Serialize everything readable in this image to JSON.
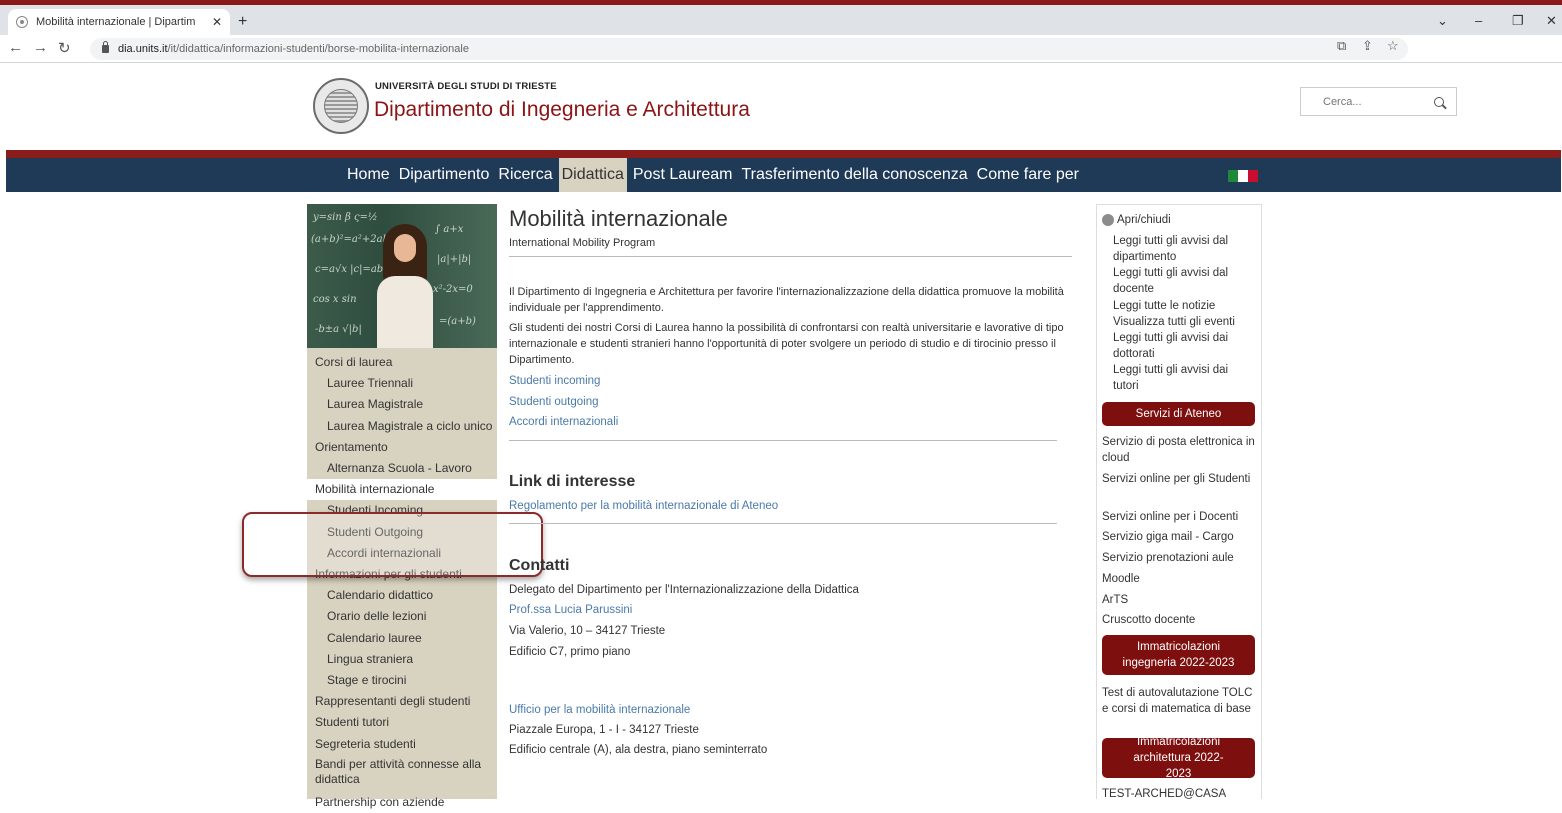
{
  "browser": {
    "tab_title": "Mobilità internazionale | Dipartim",
    "tab_close": "✕",
    "new_tab": "+",
    "url_domain": "dia.units.it",
    "url_path": "/it/didattica/informazioni-studenti/borse-mobilita-internazionale"
  },
  "header": {
    "university": "UNIVERSITÀ DEGLI STUDI DI TRIESTE",
    "department": "Dipartimento di Ingegneria e Architettura",
    "search_placeholder": "Cerca..."
  },
  "nav": {
    "items": [
      "Home",
      "Dipartimento",
      "Ricerca",
      "Didattica",
      "Post Lauream",
      "Trasferimento della conoscenza",
      "Come fare per"
    ],
    "active": "Didattica"
  },
  "sidebar": {
    "items": [
      {
        "label": "Corsi di laurea",
        "level": 0
      },
      {
        "label": "Lauree Triennali",
        "level": 1
      },
      {
        "label": "Laurea Magistrale",
        "level": 1
      },
      {
        "label": "Laurea Magistrale a ciclo unico",
        "level": 1
      },
      {
        "label": "Orientamento",
        "level": 0
      },
      {
        "label": "Alternanza Scuola - Lavoro",
        "level": 1
      },
      {
        "label": "Mobilità internazionale",
        "level": 0,
        "active": true
      },
      {
        "label": "Studenti Incoming",
        "level": 1
      },
      {
        "label": "Studenti Outgoing",
        "level": 1
      },
      {
        "label": "Accordi internazionali",
        "level": 1
      },
      {
        "label": "Informazioni per gli studenti",
        "level": 0
      },
      {
        "label": "Calendario didattico",
        "level": 1
      },
      {
        "label": "Orario delle lezioni",
        "level": 1
      },
      {
        "label": "Calendario lauree",
        "level": 1
      },
      {
        "label": "Lingua straniera",
        "level": 1
      },
      {
        "label": "Stage e tirocini",
        "level": 1
      },
      {
        "label": "Rappresentanti degli studenti",
        "level": 0
      },
      {
        "label": "Studenti tutori",
        "level": 0
      },
      {
        "label": "Segreteria studenti",
        "level": 0
      },
      {
        "label": "Bandi per attività connesse alla didattica",
        "level": 0
      },
      {
        "label": "Partnership con aziende",
        "level": 0
      }
    ]
  },
  "main": {
    "title": "Mobilità internazionale",
    "subtitle": "International Mobility Program",
    "para1": "Il Dipartimento di Ingegneria e Architettura per favorire l'internazionalizzazione della didattica promuove la mobilità individuale per l'apprendimento.",
    "para2": "Gli studenti dei nostri Corsi di Laurea hanno la possibilità di confrontarsi con realtà universitarie e lavorative di tipo internazionale e studenti stranieri hanno l'opportunità di poter svolgere un periodo di studio e di tirocinio presso il Dipartimento.",
    "links": [
      "Studenti incoming",
      "Studenti outgoing",
      "Accordi internazionali"
    ],
    "link_heading": "Link di interesse",
    "link_regolamento": "Regolamento per la mobilità internazionale di Ateneo",
    "contacts_heading": "Contatti",
    "delegato": "Delegato del Dipartimento per l'Internazionalizzazione della Didattica",
    "delegato_name": "Prof.ssa Lucia Parussini",
    "address1": "Via Valerio, 10 – 34127 Trieste",
    "building1": "Edificio C7, primo piano",
    "ufficio": "Ufficio per la mobilità internazionale",
    "address2": "Piazzale Europa, 1 - I - 34127 Trieste",
    "building2": "Edificio centrale (A), ala destra, piano seminterrato"
  },
  "right": {
    "toggle": "Apri/chiudi",
    "avvisi": [
      "Leggi tutti gli avvisi dal dipartimento",
      "Leggi tutti gli avvisi dal docente",
      "Leggi tutte le notizie",
      "Visualizza tutti gli eventi",
      "Leggi tutti gli avvisi dai dottorati",
      "Leggi tutti gli avvisi dai tutori"
    ],
    "servizi_btn": "Servizi di Ateneo",
    "servizi": [
      "Servizio di posta elettronica in cloud",
      "Servizi online per gli Studenti",
      "Servizi online per i Docenti",
      "Servizio giga mail - Cargo",
      "Servizio prenotazioni aule",
      "Moodle",
      "ArTS",
      "Cruscotto docente"
    ],
    "imm_ing_btn": "Immatricolazioni ingegneria 2022-2023",
    "test_tolc": "Test di autovalutazione TOLC e corsi di matematica di base",
    "imm_arch_btn": "Immatricolazioni architettura 2022-2023",
    "test_arched": "TEST-ARCHED@CASA"
  },
  "colors": {
    "brand_red": "#8b1414",
    "navbar": "#1e3a57",
    "sidebar_bg": "#d8d2c0",
    "link": "#4a7aa8"
  }
}
